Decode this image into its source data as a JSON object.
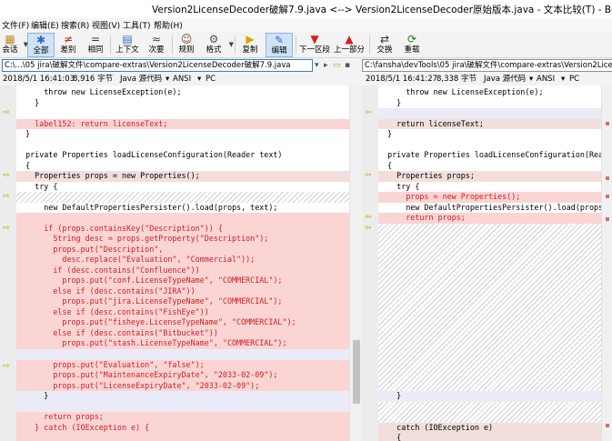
{
  "window": {
    "title": "Version2LicenseDecoder破解7.9.java <--> Version2LicenseDecoder原始版本.java - 文本比较(T) - Beyond Compare"
  },
  "menu": [
    "文件(F)",
    "编辑(E)",
    "搜索(R)",
    "视图(V)",
    "工具(T)",
    "帮助(H)"
  ],
  "toolbar": {
    "items": [
      {
        "label": "会话",
        "icon": "▦"
      },
      {
        "label": "全部",
        "icon": "✱"
      },
      {
        "label": "差别",
        "icon": "≠"
      },
      {
        "label": "相同",
        "icon": "="
      },
      {
        "label": "上下文",
        "icon": "▤"
      },
      {
        "label": "次要",
        "icon": "≈"
      },
      {
        "label": "规则",
        "icon": "☺"
      },
      {
        "label": "格式",
        "icon": "⚙"
      },
      {
        "label": "复制",
        "icon": "▶"
      },
      {
        "label": "编辑",
        "icon": "✎"
      },
      {
        "label": "下一区段",
        "icon": "▼"
      },
      {
        "label": "上一部分",
        "icon": "▲"
      },
      {
        "label": "交换",
        "icon": "⇄"
      },
      {
        "label": "重载",
        "icon": "⟳"
      }
    ]
  },
  "left": {
    "path": "C:\\...\\05 jira\\破解文件\\compare-extras\\Version2LicenseDecoder破解7.9.java",
    "timestamp": "2018/5/1 16:41:03",
    "size": "8,916 字节",
    "language": "Java 源代码",
    "encoding": "ANSI",
    "lineend": "PC"
  },
  "right": {
    "path": "C:\\fansha\\devTools\\05 jira\\破解文件\\compare-extras\\Version2LicenseDecoder原始版本.java",
    "timestamp": "2018/5/1 16:41:27",
    "size": "8,338 字节",
    "language": "Java 源代码",
    "encoding": "ANSI",
    "lineend": "PC"
  },
  "code": {
    "left": {
      "l0": "      throw new LicenseException(e);",
      "l1": "    }",
      "l3": "    label152: return licenseText;",
      "l4": "  }",
      "l6": "  private Properties loadLicenseConfiguration(Reader text)",
      "l7": "  {",
      "l8": "    Properties props = new Properties();",
      "l9": "    try {",
      "l11": "      new DefaultPropertiesPersister().load(props, text);",
      "b1": "      if (props.containsKey(\"Description\")) {",
      "b2": "        String desc = props.getProperty(\"Description\");",
      "b3": "        props.put(\"Description\",",
      "b4": "          desc.replace(\"Evaluation\", \"Commercial\"));",
      "b5": "        if (desc.contains(\"Confluence\"))",
      "b6": "          props.put(\"conf.LicenseTypeName\", \"COMMERCIAL\");",
      "b7": "        else if (desc.contains(\"JIRA\"))",
      "b8": "          props.put(\"jira.LicenseTypeName\", \"COMMERCIAL\");",
      "b9": "        else if (desc.contains(\"FishEye\"))",
      "b10": "          props.put(\"fisheye.LicenseTypeName\", \"COMMERCIAL\");",
      "b11": "        else if (desc.contains(\"Bitbucket\"))",
      "b12": "          props.put(\"stash.LicenseTypeName\", \"COMMERCIAL\");",
      "c1": "        props.put(\"Evaluation\", \"false\");",
      "c2": "        props.put(\"MaintenanceExpiryDate\", \"2033-02-09\");",
      "c3": "        props.put(\"LicenseExpiryDate\", \"2033-02-09\");",
      "c4": "      }",
      "d1": "      return props;",
      "d2": "    } catch (IOException e) {"
    },
    "right": {
      "r0": "      throw new LicenseException(e);",
      "r1": "    }",
      "r3": "    return licenseText;",
      "r4": "  }",
      "r6": "  private Properties loadLicenseConfiguration(Reader text)",
      "r7": "  {",
      "r8": "    Properties props;",
      "r9": "    try {",
      "r10": "      props = new Properties();",
      "r11": "      new DefaultPropertiesPersister().load(props, text);",
      "r12": "      return props;",
      "r13": "    }",
      "r14": "    catch (IOException e)",
      "r15": "    {"
    }
  }
}
